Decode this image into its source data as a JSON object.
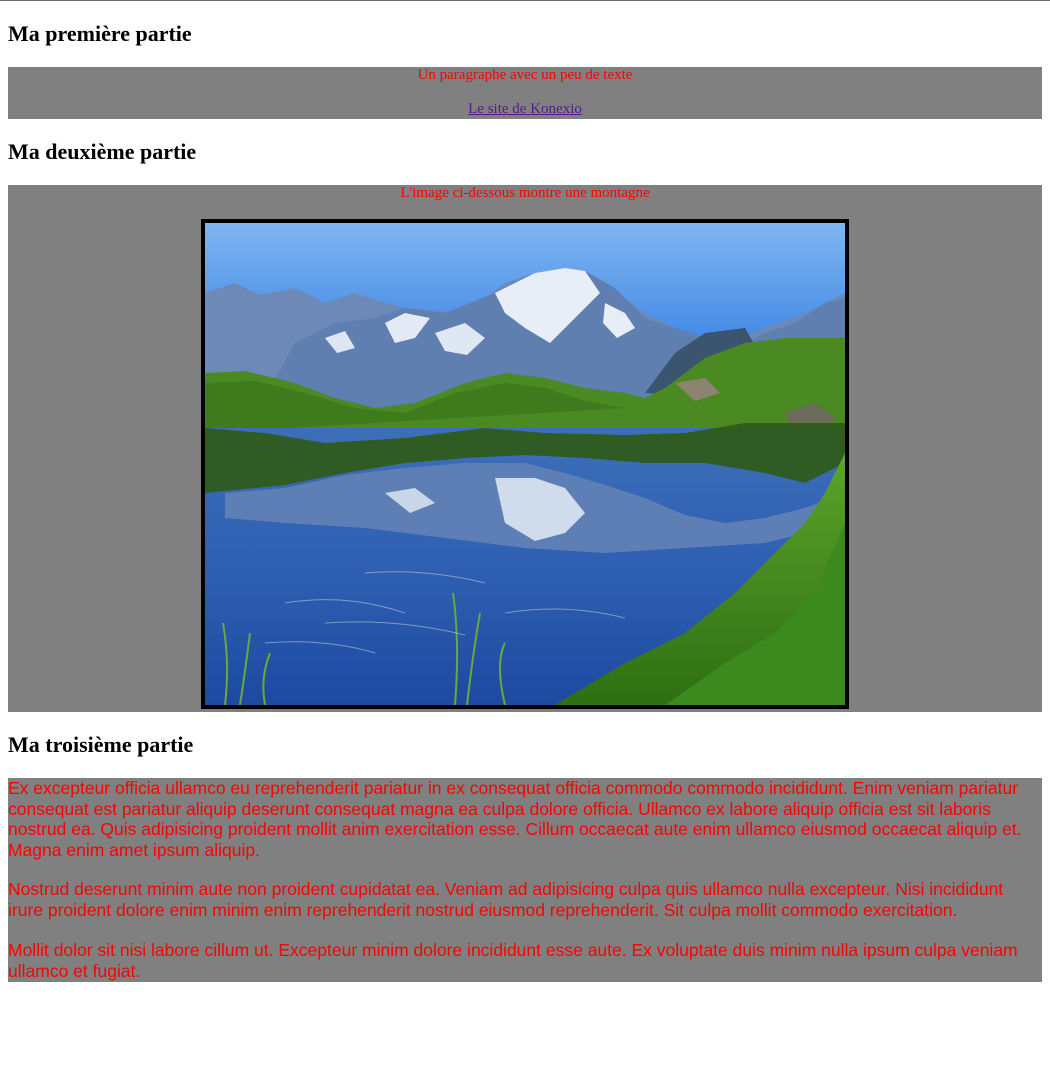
{
  "part1": {
    "title": "Ma première partie",
    "paragraph": "Un paragraphe avec un peu de texte",
    "link": "Le site de Konexio"
  },
  "part2": {
    "title": "Ma deuxième partie",
    "caption": "L'image ci-dessous montre une montagne"
  },
  "part3": {
    "title": "Ma troisième partie",
    "paragraphs": [
      "Ex excepteur officia ullamco eu reprehenderit pariatur in ex consequat officia commodo commodo incididunt. Enim veniam pariatur consequat est pariatur aliquip deserunt consequat magna ea culpa dolore officia. Ullamco ex labore aliquip officia est sit laboris nostrud ea. Quis adipisicing proident mollit anim exercitation esse. Cillum occaecat aute enim ullamco eiusmod occaecat aliquip et. Magna enim amet ipsum aliquip.",
      "Nostrud deserunt minim aute non proident cupidatat ea. Veniam ad adipisicing culpa quis ullamco nulla excepteur. Nisi incididunt irure proident dolore enim minim enim reprehenderit nostrud eiusmod reprehenderit. Sit culpa mollit commodo exercitation.",
      "Mollit dolor sit nisi labore cillum ut. Excepteur minim dolore incididunt esse aute. Ex voluptate duis minim nulla ipsum culpa veniam ullamco et fugiat."
    ]
  },
  "colors": {
    "box_background": "#808080",
    "text_red": "#ff0000",
    "link_visited": "#551a8b"
  }
}
